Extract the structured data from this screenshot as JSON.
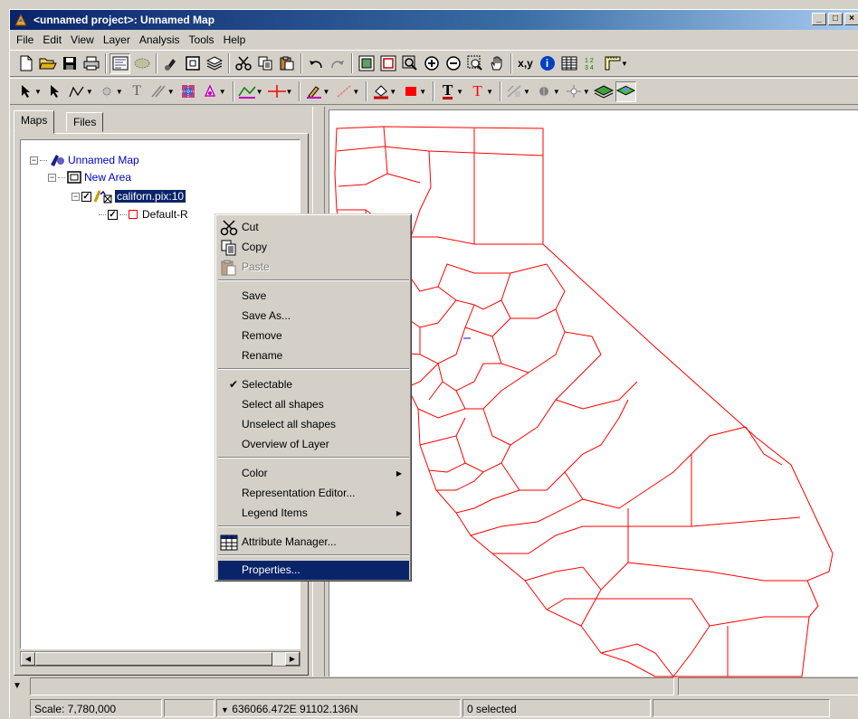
{
  "window": {
    "title": "<unnamed project>: Unnamed Map",
    "buttons": [
      "_",
      "□",
      "×"
    ]
  },
  "menubar": [
    "File",
    "Edit",
    "View",
    "Layer",
    "Analysis",
    "Tools",
    "Help"
  ],
  "toolbar1": {
    "icons": [
      "new-icon",
      "open-icon",
      "save-icon",
      "print-icon",
      "map-view-icon",
      "layer-icon",
      "paint-icon",
      "rectangle-icon",
      "layers-icon",
      "cut-icon",
      "copy-icon",
      "paste-icon",
      "undo-icon",
      "redo-icon",
      "zoom-extent-icon",
      "zoom-layer-icon",
      "zoom-box-icon",
      "zoom-in-icon",
      "zoom-out-icon",
      "zoom-select-icon",
      "pan-icon",
      "xy-icon",
      "info-icon",
      "table-icon",
      "ruler-icon"
    ],
    "xy_label": "x,y",
    "info_label": "i"
  },
  "toolbar2": {
    "icons": [
      "select-icon",
      "pointer-icon",
      "polyline-icon",
      "node-icon",
      "text-icon",
      "edit-icon",
      "color-icon",
      "fill-icon",
      "line-style-icon",
      "cross-icon",
      "pen-icon",
      "line-icon",
      "fill-color-icon",
      "red-fill-icon",
      "text-color-icon",
      "text-style-icon",
      "symbol-icon",
      "point-icon",
      "stack-icon"
    ],
    "text_T": "T"
  },
  "left_panel": {
    "tabs": [
      "Maps",
      "Files"
    ],
    "tree": {
      "map": "Unnamed Map",
      "area": "New Area",
      "layer": "californ.pix:10",
      "rep": "Default-R"
    }
  },
  "context_menu": {
    "items": [
      {
        "label": "Cut",
        "icon": "cut-icon"
      },
      {
        "label": "Copy",
        "icon": "copy-icon"
      },
      {
        "label": "Paste",
        "icon": "paste-icon",
        "disabled": true
      },
      {
        "label": "Save"
      },
      {
        "label": "Save As..."
      },
      {
        "label": "Remove"
      },
      {
        "label": "Rename"
      },
      {
        "label": "Selectable",
        "checked": true
      },
      {
        "label": "Select all shapes"
      },
      {
        "label": "Unselect all shapes"
      },
      {
        "label": "Overview of Layer"
      },
      {
        "label": "Color",
        "submenu": true
      },
      {
        "label": "Representation Editor..."
      },
      {
        "label": "Legend Items",
        "submenu": true
      },
      {
        "label": "Attribute Manager...",
        "icon": "table-icon"
      },
      {
        "label": "Properties...",
        "highlighted": true
      }
    ]
  },
  "statusbar": {
    "scale": "Scale: 7,780,000",
    "empty": "",
    "coords": "636066.472E 91102.136N",
    "selected": "0 selected"
  },
  "colors": {
    "map_line": "#ff0000",
    "title_start": "#0a246a",
    "highlight": "#0a246a"
  }
}
